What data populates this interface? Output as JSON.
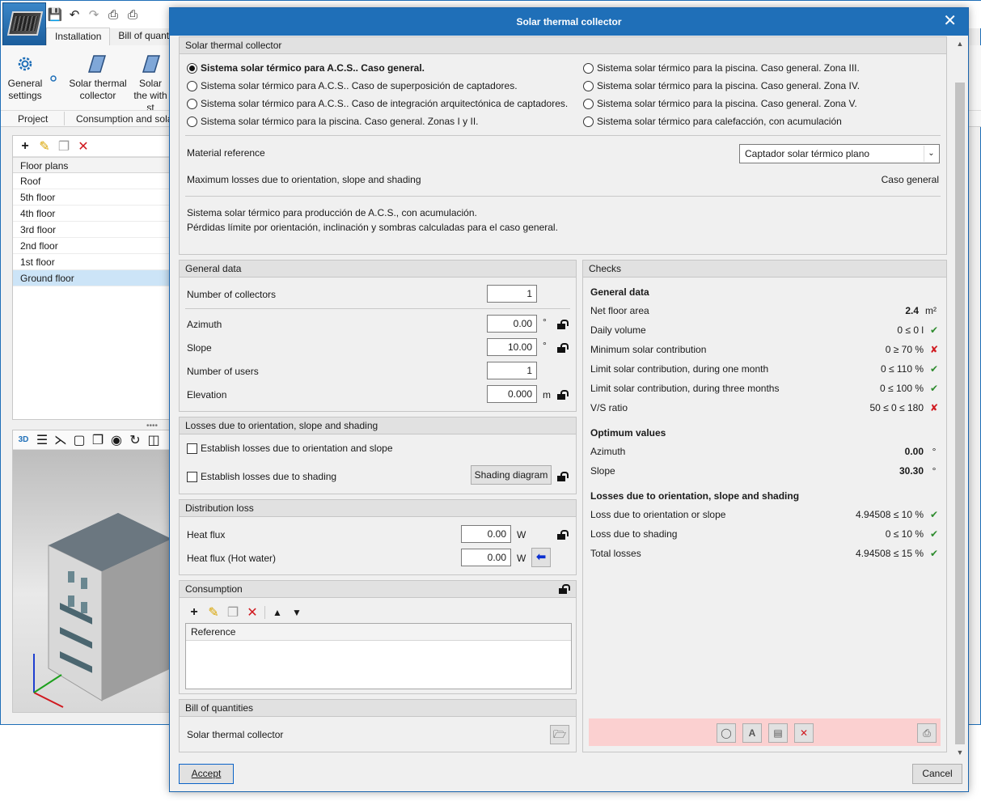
{
  "app": {
    "ribbon_tabs": [
      "Installation",
      "Bill of quantities"
    ],
    "buttons": {
      "general_settings": "General settings",
      "solar_collector": "Solar thermal collector",
      "solar_with_storage": "Solar the with st"
    },
    "groups": {
      "project": "Project",
      "consumption": "Consumption and sola"
    },
    "floor_plans": {
      "header": "Floor plans",
      "items": [
        "Roof",
        "5th floor",
        "4th floor",
        "3rd floor",
        "2nd floor",
        "1st floor",
        "Ground floor"
      ],
      "selected": "Ground floor"
    }
  },
  "dialog": {
    "title": "Solar thermal collector",
    "collector_panel": {
      "title": "Solar thermal collector",
      "options": [
        "Sistema solar térmico para A.C.S.. Caso general.",
        "Sistema solar térmico para A.C.S.. Caso de superposición de captadores.",
        "Sistema solar térmico para A.C.S.. Caso de integración arquitectónica de captadores.",
        "Sistema solar térmico para la piscina. Caso general. Zonas I y II.",
        "Sistema solar térmico para la piscina. Caso general. Zona III.",
        "Sistema solar térmico para la piscina. Caso general. Zona IV.",
        "Sistema solar térmico para la piscina. Caso general. Zona V.",
        "Sistema solar térmico para calefacción, con acumulación"
      ],
      "selected": "Sistema solar térmico para A.C.S.. Caso general.",
      "material_label": "Material reference",
      "material_value": "Captador solar térmico plano",
      "max_losses_label": "Maximum losses due to orientation, slope and shading",
      "max_losses_value": "Caso general",
      "description_line1": "Sistema solar térmico para producción de A.C.S., con acumulación.",
      "description_line2": "Pérdidas límite por orientación, inclinación y sombras calculadas para el caso general."
    },
    "general_data": {
      "title": "General data",
      "collectors_label": "Number of collectors",
      "collectors_value": "1",
      "azimuth_label": "Azimuth",
      "azimuth_value": "0.00",
      "azimuth_unit": "°",
      "slope_label": "Slope",
      "slope_value": "10.00",
      "slope_unit": "°",
      "users_label": "Number of users",
      "users_value": "1",
      "elevation_label": "Elevation",
      "elevation_value": "0.000",
      "elevation_unit": "m"
    },
    "losses": {
      "title": "Losses due to orientation, slope and shading",
      "orientation_checkbox": "Establish losses due to orientation and slope",
      "shading_checkbox": "Establish losses due to shading",
      "shading_button": "Shading diagram"
    },
    "distribution": {
      "title": "Distribution loss",
      "heat_flux_label": "Heat flux",
      "heat_flux_value": "0.00",
      "heat_flux_unit": "W",
      "hot_water_label": "Heat flux (Hot water)",
      "hot_water_value": "0.00",
      "hot_water_unit": "W"
    },
    "consumption": {
      "title": "Consumption",
      "column": "Reference"
    },
    "bill": {
      "title": "Bill of quantities",
      "item": "Solar thermal collector"
    },
    "checks": {
      "title": "Checks",
      "general_title": "General data",
      "net_floor_label": "Net floor area",
      "net_floor_value": "2.4",
      "net_floor_unit": "m²",
      "daily_volume_label": "Daily volume",
      "daily_volume_value": "0 ≤ 0  l",
      "min_solar_label": "Minimum solar contribution",
      "min_solar_value": "0 ≥ 70  %",
      "limit_month_label": "Limit solar contribution, during one month",
      "limit_month_value": "0 ≤ 110  %",
      "limit_three_label": "Limit solar contribution, during three months",
      "limit_three_value": "0 ≤ 100  %",
      "vs_ratio_label": "V/S ratio",
      "vs_ratio_value": "50 ≤ 0 ≤ 180",
      "optimum_title": "Optimum values",
      "opt_azimuth_label": "Azimuth",
      "opt_azimuth_value": "0.00",
      "opt_azimuth_unit": "°",
      "opt_slope_label": "Slope",
      "opt_slope_value": "30.30",
      "opt_slope_unit": "°",
      "losses_title": "Losses due to orientation, slope and shading",
      "loss_orient_label": "Loss due to orientation or slope",
      "loss_orient_value": "4.94508 ≤ 10  %",
      "loss_shading_label": "Loss due to shading",
      "loss_shading_value": "0 ≤ 10  %",
      "total_label": "Total losses",
      "total_value": "4.94508 ≤ 15  %"
    },
    "accept": "Accept",
    "cancel": "Cancel"
  },
  "colors": {
    "title_bar": "#1f6fb8",
    "ok": "#2e8b2e",
    "fail": "#d0191f",
    "toolbar_warning_bg": "#fbd0d0"
  }
}
